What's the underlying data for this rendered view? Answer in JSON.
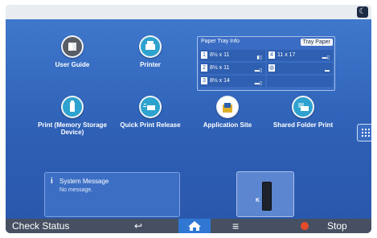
{
  "apps": [
    {
      "id": "user-guide",
      "label": "User Guide",
      "icon": "book-icon"
    },
    {
      "id": "printer",
      "label": "Printer",
      "icon": "printer-icon"
    },
    {
      "id": "print-memory",
      "label": "Print (Memory Storage Device)",
      "icon": "usb-icon"
    },
    {
      "id": "quick-print",
      "label": "Quick Print Release",
      "icon": "quick-print-icon"
    },
    {
      "id": "app-site",
      "label": "Application Site",
      "icon": "bag-icon"
    },
    {
      "id": "shared-folder",
      "label": "Shared Folder Print",
      "icon": "folder-printer-icon"
    }
  ],
  "tray": {
    "title": "Paper Tray Info",
    "button": "Tray Paper",
    "rows": [
      {
        "num": "1",
        "size": "8½ x 11"
      },
      {
        "num": "2",
        "size": "8½ x 11"
      },
      {
        "num": "3",
        "size": "8½ x 14"
      },
      {
        "num": "4",
        "size": "11 x 17"
      }
    ]
  },
  "system_message": {
    "title": "System Message",
    "text": "No message."
  },
  "toner": {
    "label": "K",
    "level": 0.85
  },
  "bottom": {
    "check_status": "Check Status",
    "stop": "Stop"
  },
  "colors": {
    "accent": "#2f77d3",
    "background": "#2d5fb5",
    "bottom_bar": "#465062"
  }
}
